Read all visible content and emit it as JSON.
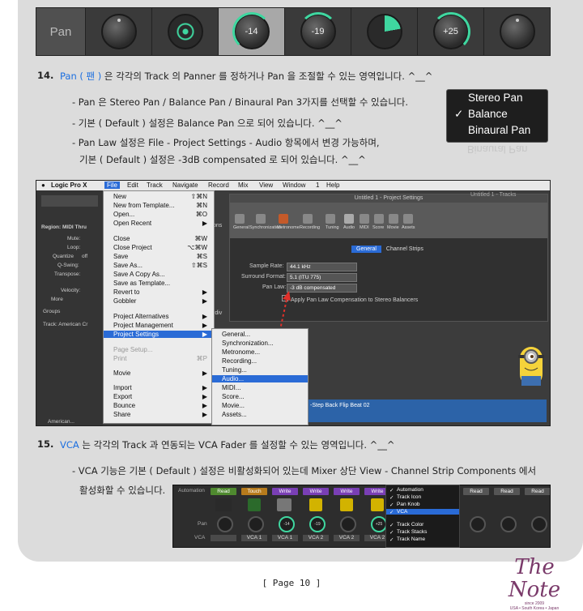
{
  "pan_strip": {
    "label": "Pan",
    "values": [
      "",
      "",
      "-14",
      "-19",
      "",
      "+25",
      ""
    ]
  },
  "section14": {
    "num": "14.",
    "title_blue": "Pan ( 팬 )",
    "title_rest": " 은 각각의 Track 의 Panner 를 정하거나 Pan 을 조절할 수 있는 영역입니다. ^__^",
    "b1": "- Pan 은  Stereo Pan / Balance Pan /  Binaural Pan 3가지를 선택할 수 있습니다.",
    "b2": "- 기본 ( Default ) 설정은 Balance Pan 으로 되어 있습니다. ^__^",
    "b3": "- Pan Law 설정은 File - Project Settings - Audio 항목에서 변경 가능하며,",
    "b4": "기본 ( Default ) 설정은 -3dB compensated 로 되어 있습니다. ^__^"
  },
  "pan_menu": {
    "items": [
      "Stereo Pan",
      "Balance",
      "Binaural Pan"
    ],
    "check": "✓",
    "reflection": "Binaural Pan"
  },
  "logic": {
    "menubar": [
      "Logic Pro X",
      "File",
      "Edit",
      "Track",
      "Navigate",
      "Record",
      "Mix",
      "View",
      "Window",
      "1",
      "Help"
    ],
    "file_menu": [
      {
        "label": "New",
        "sc": "⇧⌘N"
      },
      {
        "label": "New from Template...",
        "sc": "⌘N"
      },
      {
        "label": "Open...",
        "sc": "⌘O"
      },
      {
        "label": "Open Recent",
        "sc": "▶"
      },
      {
        "label": "Close",
        "sc": "⌘W"
      },
      {
        "label": "Close Project",
        "sc": "⌥⌘W"
      },
      {
        "label": "Save",
        "sc": "⌘S"
      },
      {
        "label": "Save As...",
        "sc": "⇧⌘S"
      },
      {
        "label": "Save A Copy As...",
        "sc": ""
      },
      {
        "label": "Save as Template...",
        "sc": ""
      },
      {
        "label": "Revert to",
        "sc": "▶"
      },
      {
        "label": "Gobbler",
        "sc": "▶"
      },
      {
        "label": "Project Alternatives",
        "sc": "▶"
      },
      {
        "label": "Project Management",
        "sc": "▶"
      },
      {
        "label": "Project Settings",
        "sc": "▶"
      },
      {
        "label": "Page Setup...",
        "sc": ""
      },
      {
        "label": "Print",
        "sc": "⌘P"
      },
      {
        "label": "Movie",
        "sc": "▶"
      },
      {
        "label": "Import",
        "sc": "▶"
      },
      {
        "label": "Export",
        "sc": "▶"
      },
      {
        "label": "Bounce",
        "sc": "▶"
      },
      {
        "label": "Share",
        "sc": "▶"
      }
    ],
    "sub_menu": [
      "General...",
      "Synchronization...",
      "Metronome...",
      "Recording...",
      "Tuning...",
      "Audio...",
      "MIDI...",
      "Score...",
      "Movie...",
      "Assets..."
    ],
    "window_title": "Untitled 1 - Project Settings",
    "window_title2": "Untitled 1 - Tracks",
    "tools": [
      "General",
      "Synchronization",
      "Metronome",
      "Recording",
      "Tuning",
      "Audio",
      "MIDI",
      "Score",
      "Movie",
      "Assets"
    ],
    "tabs": [
      "General",
      "Channel Strips"
    ],
    "fields": {
      "sample_rate_label": "Sample Rate:",
      "sample_rate": "44.1 kHz",
      "surround_label": "Surround Format:",
      "surround": "5.1 (ITU 775)",
      "panlaw_label": "Pan Law:",
      "panlaw": "-3 dB compensated",
      "apply": "Apply Pan Law Compensation to Stereo Balancers"
    },
    "side": {
      "region": "Region: MIDI Thru",
      "mute": "Mute:",
      "loop": "Loop:",
      "quantize": "Quantize",
      "quantize_val": "off",
      "qswing": "Q-Swing:",
      "transpose": "Transpose:",
      "velocity": "Velocity:",
      "more": "More",
      "groups": "Groups",
      "track": "Track: American Cr",
      "american": "American..."
    },
    "region_label": "-Step Back Flip Beat 02",
    "partial_ons": "ons",
    "partial_rdiv": "rdiv"
  },
  "section15": {
    "num": "15.",
    "title_blue": "VCA",
    "title_rest": " 는 각각의 Track 과 연동되는 VCA Fader 를 설정할 수 있는 영역입니다. ^__^",
    "b1": "- VCA 기능은 기본 ( Default ) 설정은 비활성화되어 있는데 Mixer 상단 View - Channel Strip Components 에서",
    "b2": "활성화할 수 있습니다."
  },
  "channel_strip": {
    "automation": "Automation",
    "pan": "Pan",
    "vca": "VCA",
    "modes": [
      "Read",
      "Touch",
      "Write",
      "Write",
      "Write",
      "Write",
      "Read",
      "Read",
      "Read"
    ],
    "pan_values": [
      "",
      "",
      "-14",
      "-19",
      "",
      "+25"
    ],
    "vca_values": [
      "",
      "VCA 1",
      "VCA 1",
      "VCA 2",
      "VCA 2",
      "VCA 2"
    ],
    "menu": [
      "Automation",
      "Track Icon",
      "Pan Knob",
      "VCA",
      "Track Color",
      "Track Stacks",
      "Track Name"
    ]
  },
  "footer": "[  Page  10  ]",
  "logo": {
    "title": "The Note",
    "tag": "since 2009",
    "sub": "USA • South Korea • Japan"
  },
  "colors": {
    "blue": "#1c6fe0",
    "green": "#3fd7a0",
    "panel": "#dcdcdc"
  }
}
